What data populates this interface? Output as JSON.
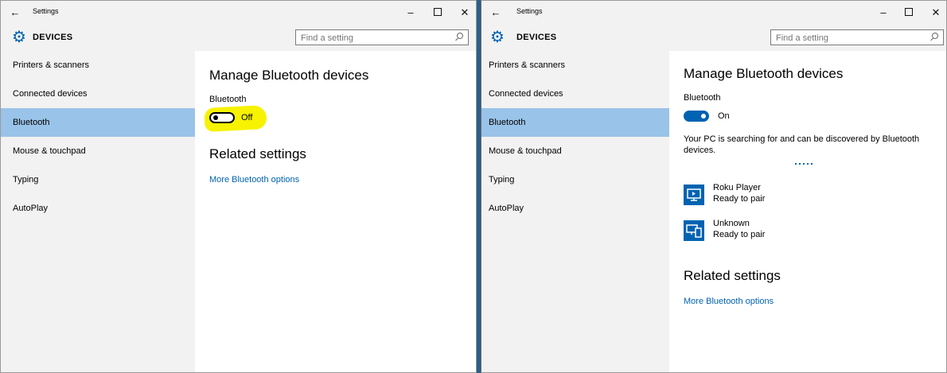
{
  "windows": [
    {
      "title": "Settings",
      "header_title": "DEVICES",
      "search_placeholder": "Find a setting",
      "nav": [
        "Printers & scanners",
        "Connected devices",
        "Bluetooth",
        "Mouse & touchpad",
        "Typing",
        "AutoPlay"
      ],
      "selected_nav": "Bluetooth",
      "heading": "Manage Bluetooth devices",
      "bluetooth_label": "Bluetooth",
      "toggle_state": "Off",
      "related_heading": "Related settings",
      "related_link": "More Bluetooth options"
    },
    {
      "title": "Settings",
      "header_title": "DEVICES",
      "search_placeholder": "Find a setting",
      "nav": [
        "Printers & scanners",
        "Connected devices",
        "Bluetooth",
        "Mouse & touchpad",
        "Typing",
        "AutoPlay"
      ],
      "selected_nav": "Bluetooth",
      "heading": "Manage Bluetooth devices",
      "bluetooth_label": "Bluetooth",
      "toggle_state": "On",
      "status_text": "Your PC is searching for and can be discovered by Bluetooth devices.",
      "devices": [
        {
          "name": "Roku Player",
          "status": "Ready to pair",
          "icon": "tv-icon"
        },
        {
          "name": "Unknown",
          "status": "Ready to pair",
          "icon": "devices-icon"
        }
      ],
      "related_heading": "Related settings",
      "related_link": "More Bluetooth options"
    }
  ],
  "icons": {
    "back": "back-arrow-icon",
    "minimize": "minimize-icon",
    "maximize": "maximize-icon",
    "close": "close-icon",
    "gear": "gear-icon",
    "search": "search-icon"
  },
  "colors": {
    "accent": "#0063b1",
    "selected_nav_bg": "#99c3e8",
    "chrome_bg": "#f2f2f2",
    "highlight": "#f6f200"
  }
}
